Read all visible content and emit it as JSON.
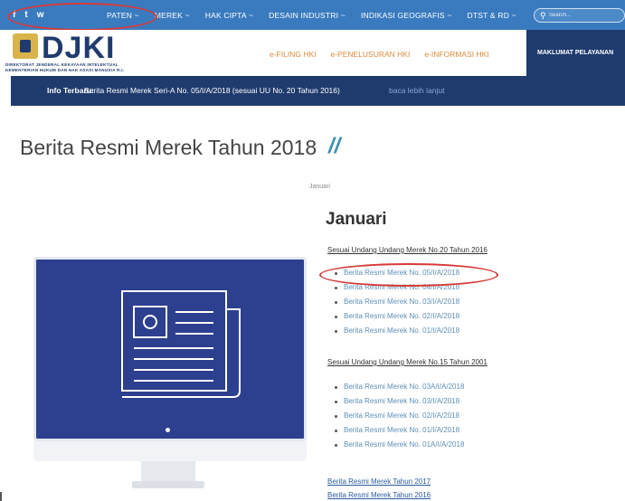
{
  "social": [
    "f",
    "t",
    "w"
  ],
  "nav": {
    "items": [
      "PATEN ~",
      "MEREK ~",
      "HAK CIPTA ~",
      "DESAIN INDUSTRI ~",
      "INDIKASI GEOGRAFIS ~",
      "DTST & RD ~"
    ],
    "search_placeholder": "Search..."
  },
  "header": {
    "logo_text": "DJKI",
    "logo_sub1": "DIREKTORAT JENDERAL KEKAYAAN INTELEKTUAL",
    "logo_sub2": "KEMENTERIAN HUKUM DAN HAK ASASI MANUSIA R.I.",
    "links": [
      "e-FILING HKI",
      "e-PENELUSURAN HKI",
      "e-INFORMASI HKI"
    ],
    "maklumat": "MAKLUMAT PELAYANAN"
  },
  "info": {
    "label": "Info Terbaru:",
    "text": "Berita Resmi Merek Seri-A No. 05/I/A/2018 (sesuai UU No. 20 Tahun 2016)",
    "more": "baca lebih lanjut"
  },
  "page": {
    "title": "Berita Resmi Merek Tahun 2018",
    "title_mark": "//",
    "breadcrumb": "Januari"
  },
  "content": {
    "section_title": "Januari",
    "group1_title": "Sesuai Undang Undang Merek No.20 Tahun 2016",
    "group1_items": [
      "Berita Resmi Merek No. 05/I/A/2018",
      "Berita Resmi Merek No. 04/I/A/2018",
      "Berita Resmi Merek No. 03/I/A/2018",
      "Berita Resmi Merek No. 02/I/A/2018",
      "Berita Resmi Merek No. 01/I/A/2018"
    ],
    "group2_title": "Sesuai Undang Undang Merek No.15 Tahun 2001",
    "group2_items": [
      "Berita Resmi Merek No. 03A/I/A/2018",
      "Berita Resmi Merek No. 03/I/A/2018",
      "Berita Resmi Merek No. 02/I/A/2018",
      "Berita Resmi Merek No. 01/I/A/2018",
      "Berita Resmi Merek No. 01A/I/A/2018"
    ],
    "year_links": [
      "Berita Resmi Merek Tahun 2017",
      "Berita Resmi Merek Tahun 2016"
    ]
  },
  "colors": {
    "nav_blue": "#3a7bbf",
    "navy": "#1f3b6e",
    "link": "#5e8fb6",
    "highlight": "#d63a3a"
  }
}
